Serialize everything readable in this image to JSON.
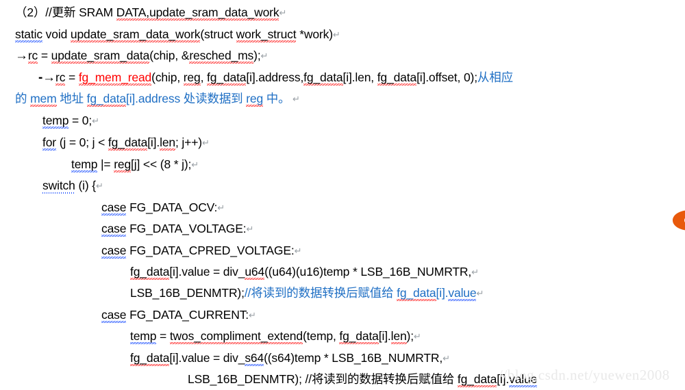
{
  "document": {
    "type": "code-snippet-screenshot",
    "background_color": "#ffffff",
    "colors": {
      "text": "#000000",
      "highlight_red": "#ff0000",
      "comment_blue": "#1f6fc4",
      "spell_error_underline": "#ff2b2b",
      "grammar_error_underline": "#2b5bff",
      "watermark": "#e9e9e9",
      "logo_orange": "#e8590c"
    },
    "lines": [
      {
        "id": "l1",
        "runs": [
          {
            "text": "（2）//更新 SRAM ",
            "color": "black"
          },
          {
            "text": "DATA,update_sram_data_work",
            "color": "black",
            "squiggle": "red"
          },
          {
            "text": "↵",
            "color": "pilcrow"
          }
        ]
      },
      {
        "id": "l2",
        "runs": [
          {
            "text": "static",
            "color": "black",
            "squiggle": "blue"
          },
          {
            "text": " void ",
            "color": "black"
          },
          {
            "text": "update_sram_data_work",
            "color": "black",
            "squiggle": "red"
          },
          {
            "text": "(struct ",
            "color": "black"
          },
          {
            "text": "work_struct",
            "color": "black",
            "squiggle": "red"
          },
          {
            "text": " *work)",
            "color": "black"
          },
          {
            "text": "↵",
            "color": "pilcrow"
          }
        ]
      },
      {
        "id": "l3",
        "runs": [
          {
            "text": "→",
            "color": "black"
          },
          {
            "text": "rc",
            "color": "black",
            "squiggle": "red"
          },
          {
            "text": " = ",
            "color": "black"
          },
          {
            "text": "update_sram_data",
            "color": "black",
            "squiggle": "red"
          },
          {
            "text": "(chip, &",
            "color": "black"
          },
          {
            "text": "resched_ms",
            "color": "black",
            "squiggle": "red"
          },
          {
            "text": ");",
            "color": "black"
          },
          {
            "text": "↵",
            "color": "pilcrow"
          }
        ]
      },
      {
        "id": "l4",
        "runs": [
          {
            "text": "-→",
            "color": "black"
          },
          {
            "text": "rc",
            "color": "black",
            "squiggle": "red"
          },
          {
            "text": " = ",
            "color": "black"
          },
          {
            "text": "fg_mem_read",
            "color": "red",
            "squiggle": "red"
          },
          {
            "text": "(chip, ",
            "color": "black"
          },
          {
            "text": "reg",
            "color": "black",
            "squiggle": "red"
          },
          {
            "text": ", ",
            "color": "black"
          },
          {
            "text": "fg_data",
            "color": "black",
            "squiggle": "red"
          },
          {
            "text": "[i].address,",
            "color": "black"
          },
          {
            "text": "fg_data",
            "color": "black",
            "squiggle": "red"
          },
          {
            "text": "[i].len, ",
            "color": "black"
          },
          {
            "text": "fg_data",
            "color": "black",
            "squiggle": "red"
          },
          {
            "text": "[i].offset, 0);",
            "color": "black"
          },
          {
            "text": "从相应",
            "color": "blue"
          }
        ]
      },
      {
        "id": "l5",
        "runs": [
          {
            "text": "的 ",
            "color": "blue"
          },
          {
            "text": "mem",
            "color": "blue",
            "squiggle": "red"
          },
          {
            "text": " 地址 ",
            "color": "blue"
          },
          {
            "text": "fg_data",
            "color": "blue",
            "squiggle": "red"
          },
          {
            "text": "[i].address 处读数据到 ",
            "color": "blue"
          },
          {
            "text": "reg",
            "color": "blue",
            "squiggle": "red"
          },
          {
            "text": " 中。",
            "color": "blue"
          },
          {
            "text": " ↵",
            "color": "pilcrow"
          }
        ]
      },
      {
        "id": "l6",
        "runs": [
          {
            "text": "temp",
            "color": "black",
            "squiggle": "blue"
          },
          {
            "text": " = 0;",
            "color": "black"
          },
          {
            "text": "↵",
            "color": "pilcrow"
          }
        ]
      },
      {
        "id": "l7",
        "runs": [
          {
            "text": "for",
            "color": "black",
            "squiggle": "blue"
          },
          {
            "text": " (j = 0; j < ",
            "color": "black"
          },
          {
            "text": "fg_data",
            "color": "black",
            "squiggle": "red"
          },
          {
            "text": "[i].",
            "color": "black"
          },
          {
            "text": "len",
            "color": "black",
            "squiggle": "red"
          },
          {
            "text": "; j++)",
            "color": "black"
          },
          {
            "text": "↵",
            "color": "pilcrow"
          }
        ]
      },
      {
        "id": "l8",
        "runs": [
          {
            "text": "temp",
            "color": "black",
            "squiggle": "blue"
          },
          {
            "text": " |= ",
            "color": "black"
          },
          {
            "text": "reg",
            "color": "black",
            "squiggle": "red"
          },
          {
            "text": "[j] << (8 * j);",
            "color": "black"
          },
          {
            "text": "↵",
            "color": "pilcrow"
          }
        ]
      },
      {
        "id": "l9",
        "runs": [
          {
            "text": "switch",
            "color": "black",
            "squiggle": "bluedot"
          },
          {
            "text": " (i) {",
            "color": "black"
          },
          {
            "text": "↵",
            "color": "pilcrow"
          }
        ]
      },
      {
        "id": "l10",
        "runs": [
          {
            "text": "case",
            "color": "black",
            "squiggle": "blue"
          },
          {
            "text": " FG_DATA_OCV:",
            "color": "black"
          },
          {
            "text": "↵",
            "color": "pilcrow"
          }
        ]
      },
      {
        "id": "l11",
        "runs": [
          {
            "text": "case",
            "color": "black",
            "squiggle": "blue"
          },
          {
            "text": " FG_DATA_VOLTAGE:",
            "color": "black"
          },
          {
            "text": "↵",
            "color": "pilcrow"
          }
        ]
      },
      {
        "id": "l12",
        "runs": [
          {
            "text": "case",
            "color": "black",
            "squiggle": "blue"
          },
          {
            "text": " FG_DATA_CPRED_VOLTAGE:",
            "color": "black"
          },
          {
            "text": "↵",
            "color": "pilcrow"
          }
        ]
      },
      {
        "id": "l13",
        "runs": [
          {
            "text": "fg_data",
            "color": "black",
            "squiggle": "red"
          },
          {
            "text": "[i].value = div_",
            "color": "black"
          },
          {
            "text": "u64",
            "color": "black",
            "squiggle": "red"
          },
          {
            "text": "((u64)(u16)temp * LSB_16B_NUMRTR,",
            "color": "black"
          },
          {
            "text": "↵",
            "color": "pilcrow"
          }
        ]
      },
      {
        "id": "l14",
        "runs": [
          {
            "text": "LSB_16B_DENMTR);",
            "color": "black"
          },
          {
            "text": "//将读到的数据转换后赋值给 ",
            "color": "blue"
          },
          {
            "text": "fg_data",
            "color": "blue",
            "squiggle": "red"
          },
          {
            "text": "[i].",
            "color": "blue"
          },
          {
            "text": "value",
            "color": "blue",
            "squiggle": "blue"
          },
          {
            "text": "↵",
            "color": "pilcrow"
          }
        ]
      },
      {
        "id": "l15",
        "runs": [
          {
            "text": "case",
            "color": "black",
            "squiggle": "blue"
          },
          {
            "text": " FG_DATA_CURRENT:",
            "color": "black"
          },
          {
            "text": "↵",
            "color": "pilcrow"
          }
        ]
      },
      {
        "id": "l16",
        "runs": [
          {
            "text": "temp",
            "color": "black",
            "squiggle": "blue"
          },
          {
            "text": " = ",
            "color": "black"
          },
          {
            "text": "twos_compliment_extend",
            "color": "black",
            "squiggle": "red"
          },
          {
            "text": "(temp, ",
            "color": "black"
          },
          {
            "text": "fg_data",
            "color": "black",
            "squiggle": "red"
          },
          {
            "text": "[i].",
            "color": "black"
          },
          {
            "text": "len",
            "color": "black",
            "squiggle": "red"
          },
          {
            "text": ");",
            "color": "black"
          },
          {
            "text": "↵",
            "color": "pilcrow"
          }
        ]
      },
      {
        "id": "l17",
        "runs": [
          {
            "text": "fg_data",
            "color": "black",
            "squiggle": "red"
          },
          {
            "text": "[i].value = div_",
            "color": "black"
          },
          {
            "text": "s64",
            "color": "black",
            "squiggle": "blue"
          },
          {
            "text": "((s64)temp * LSB_16B_NUMRTR,",
            "color": "black"
          },
          {
            "text": "↵",
            "color": "pilcrow"
          }
        ]
      },
      {
        "id": "l18",
        "runs": [
          {
            "text": "LSB_16B_DENMTR); //将读到的数据转换后赋值给 ",
            "color": "black"
          },
          {
            "text": "fg_data",
            "color": "black",
            "squiggle": "red"
          },
          {
            "text": "[i].",
            "color": "black"
          },
          {
            "text": "value",
            "color": "black",
            "squiggle": "blue"
          }
        ]
      }
    ],
    "watermark": {
      "text": "//blog.csdn.net/yuewen2008"
    },
    "edge_logo": {
      "name": "csdn-logo",
      "color": "#e8590c"
    }
  }
}
